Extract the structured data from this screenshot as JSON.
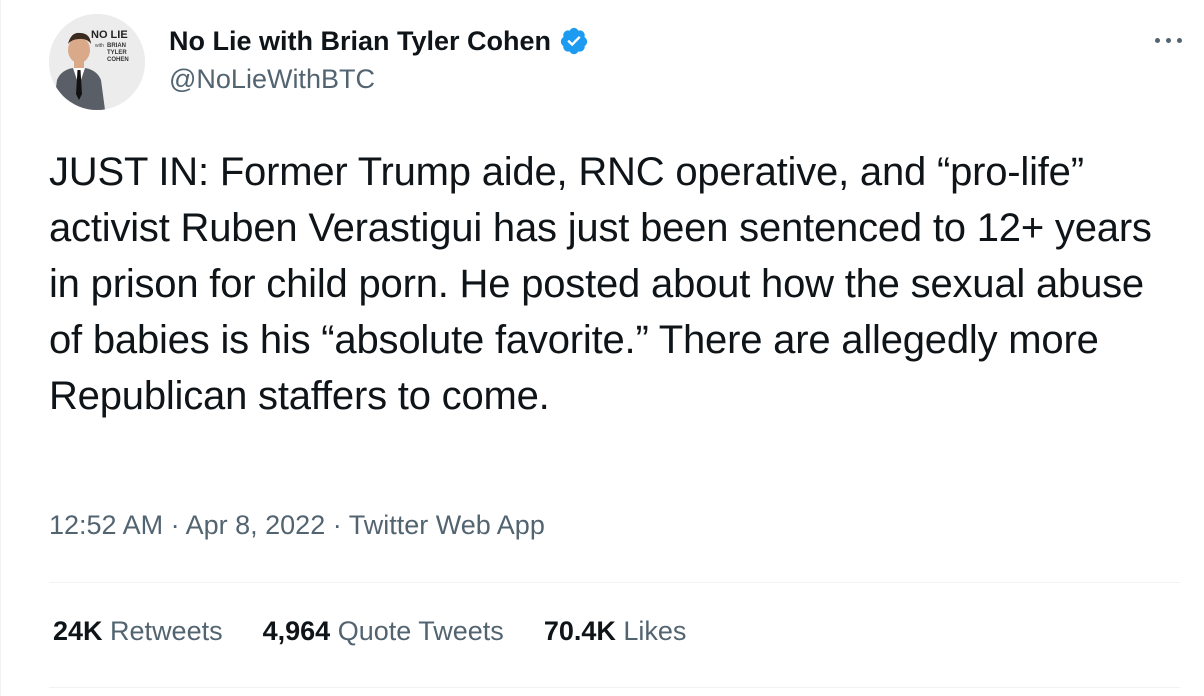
{
  "author": {
    "display_name": "No Lie with Brian Tyler Cohen",
    "handle": "@NoLieWithBTC",
    "avatar_logo_text": [
      "NO LIE",
      "with",
      "BRIAN",
      "TYLER",
      "COHEN"
    ],
    "verified": true
  },
  "tweet": {
    "text": "JUST IN: Former Trump aide, RNC operative, and “pro-life” activist Ruben Verastigui has just been sentenced to 12+ years in prison for child porn. He posted about how the sexual abuse of babies is his “absolute favorite.” There are allegedly more Republican staffers to come."
  },
  "meta": {
    "time": "12:52 AM",
    "separator": "·",
    "date": "Apr 8, 2022",
    "source": "Twitter Web App"
  },
  "stats": {
    "retweets": {
      "value": "24K",
      "label": "Retweets"
    },
    "quote_tweets": {
      "value": "4,964",
      "label": "Quote Tweets"
    },
    "likes": {
      "value": "70.4K",
      "label": "Likes"
    }
  },
  "icons": {
    "verified": "verified-badge-icon",
    "more": "more-options-icon"
  },
  "colors": {
    "text_primary": "#0f1419",
    "text_secondary": "#536471",
    "verified_blue": "#1d9bf0",
    "divider": "#eff3f4"
  }
}
